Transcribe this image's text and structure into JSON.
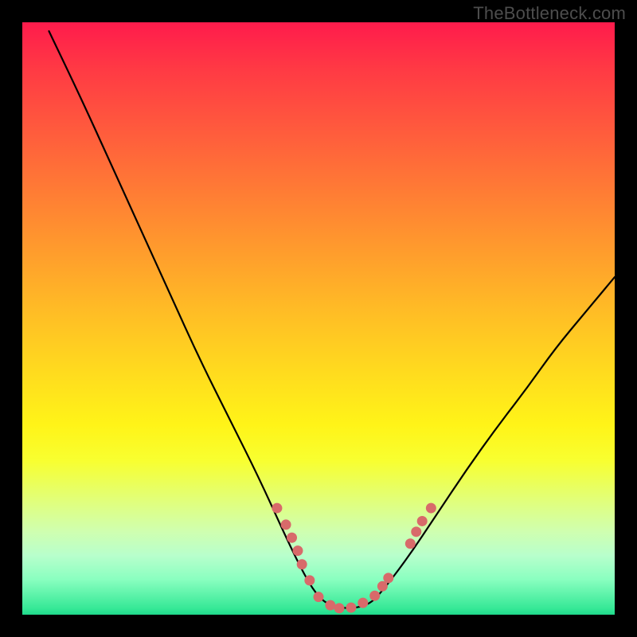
{
  "watermark": "TheBottleneck.com",
  "chart_data": {
    "type": "line",
    "title": "",
    "xlabel": "",
    "ylabel": "",
    "xlim": [
      0,
      1
    ],
    "ylim": [
      0,
      1
    ],
    "series": [
      {
        "name": "curve",
        "x": [
          0.045,
          0.1,
          0.15,
          0.2,
          0.25,
          0.3,
          0.35,
          0.4,
          0.45,
          0.48,
          0.5,
          0.52,
          0.55,
          0.58,
          0.6,
          0.65,
          0.7,
          0.75,
          0.8,
          0.85,
          0.9,
          0.95,
          1.0
        ],
        "values": [
          0.985,
          0.87,
          0.76,
          0.65,
          0.54,
          0.43,
          0.33,
          0.23,
          0.12,
          0.06,
          0.03,
          0.015,
          0.01,
          0.015,
          0.03,
          0.095,
          0.17,
          0.245,
          0.315,
          0.38,
          0.45,
          0.51,
          0.57
        ]
      }
    ],
    "markers": [
      {
        "x": 0.43,
        "y": 0.18
      },
      {
        "x": 0.445,
        "y": 0.152
      },
      {
        "x": 0.455,
        "y": 0.13
      },
      {
        "x": 0.465,
        "y": 0.108
      },
      {
        "x": 0.472,
        "y": 0.085
      },
      {
        "x": 0.485,
        "y": 0.058
      },
      {
        "x": 0.5,
        "y": 0.03
      },
      {
        "x": 0.52,
        "y": 0.016
      },
      {
        "x": 0.535,
        "y": 0.011
      },
      {
        "x": 0.555,
        "y": 0.012
      },
      {
        "x": 0.575,
        "y": 0.02
      },
      {
        "x": 0.595,
        "y": 0.032
      },
      {
        "x": 0.608,
        "y": 0.048
      },
      {
        "x": 0.618,
        "y": 0.062
      },
      {
        "x": 0.655,
        "y": 0.12
      },
      {
        "x": 0.665,
        "y": 0.14
      },
      {
        "x": 0.675,
        "y": 0.158
      },
      {
        "x": 0.69,
        "y": 0.18
      }
    ],
    "colors": {
      "curve": "#000000",
      "marker": "#d86a6a",
      "gradient_top": "#ff1b4c",
      "gradient_bottom": "#1fd98c"
    }
  }
}
